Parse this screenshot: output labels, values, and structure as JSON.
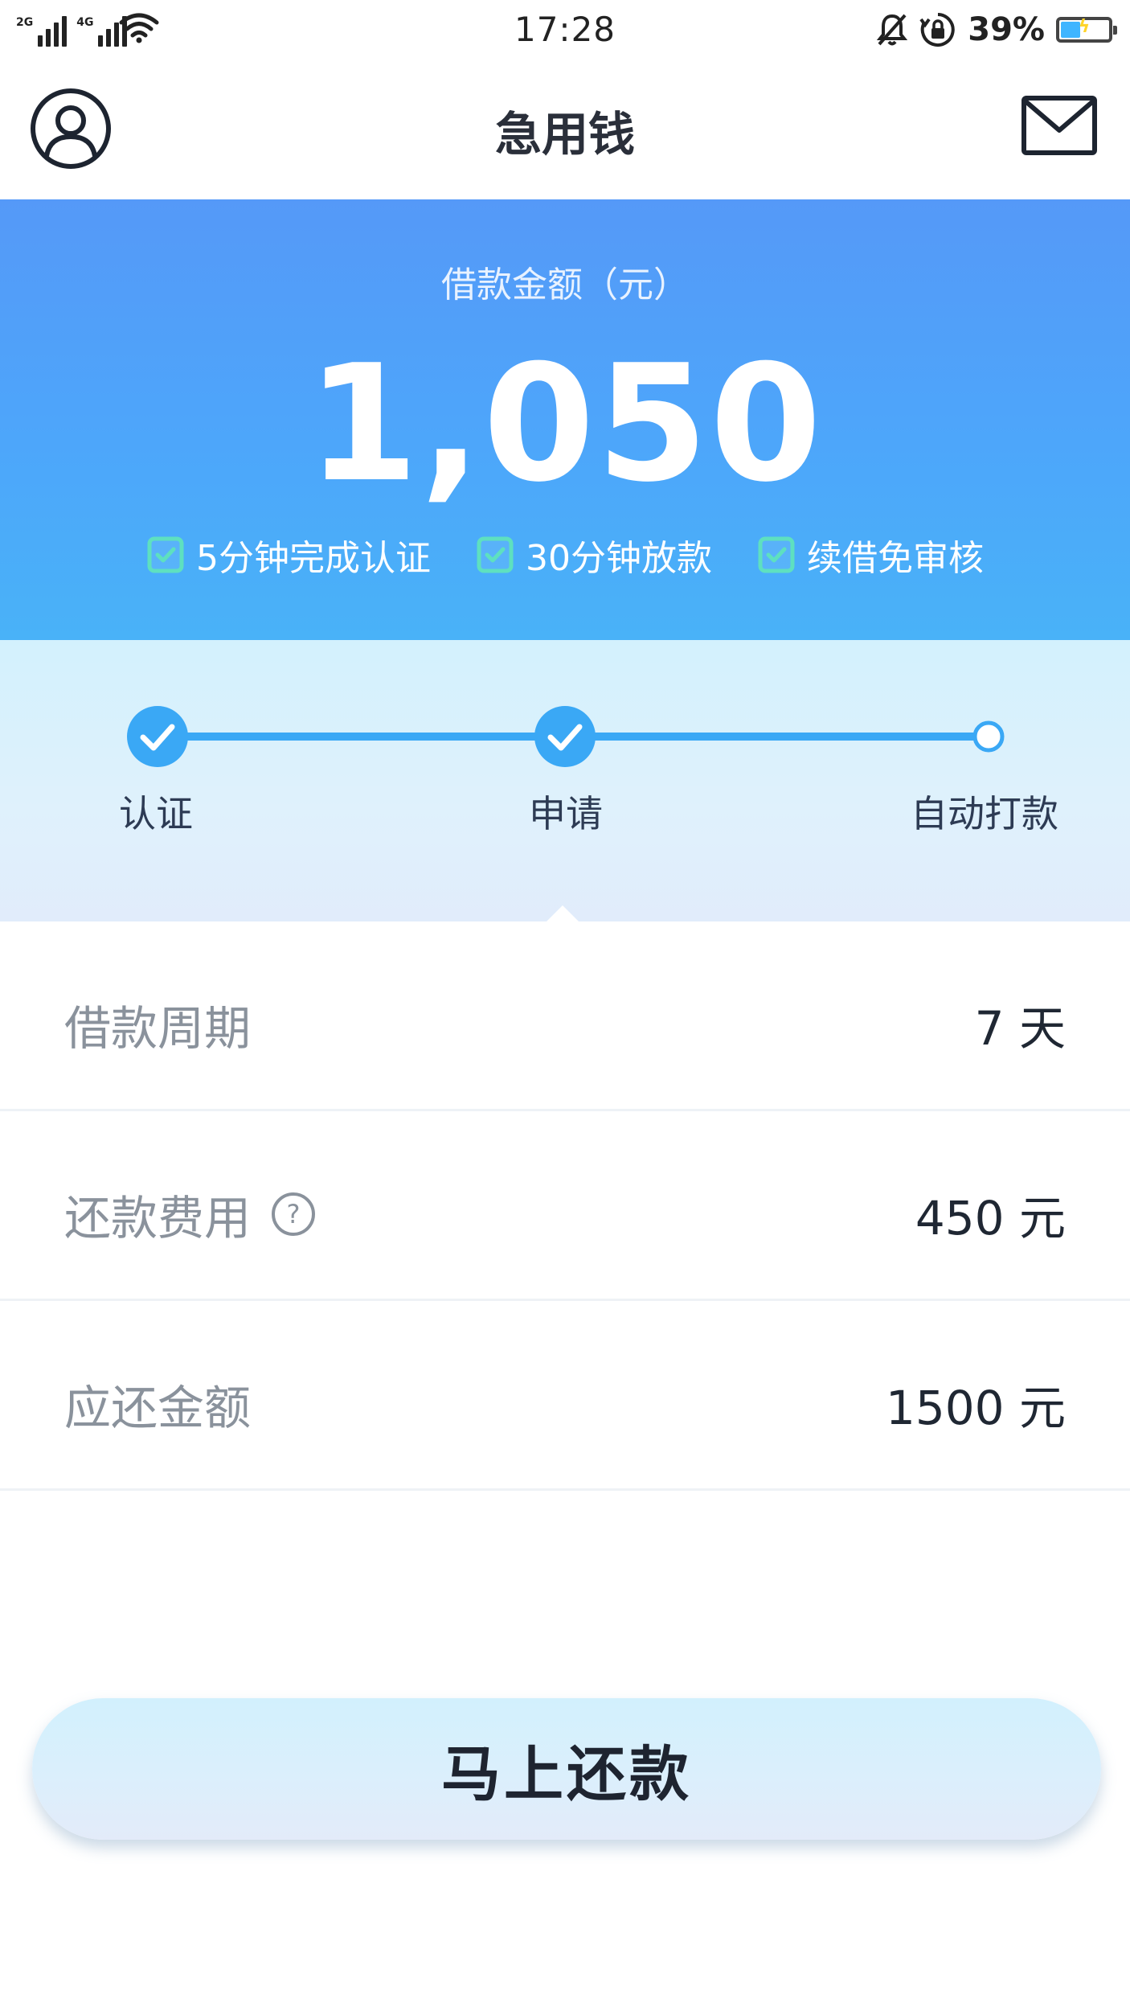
{
  "status_bar": {
    "time": "17:28",
    "battery_percent_label": "39%",
    "battery_level": 0.39,
    "network_tags": [
      "2G",
      "4G"
    ],
    "icons": [
      "signal-icon",
      "wifi-icon",
      "mute-icon",
      "rotation-lock-icon",
      "battery-icon"
    ]
  },
  "nav": {
    "title": "急用钱",
    "left_icon": "user-profile-icon",
    "right_icon": "mail-icon"
  },
  "hero": {
    "label": "借款金额（元）",
    "amount": "1,050",
    "features": [
      {
        "label": "5分钟完成认证",
        "icon": "checkbox-checked-icon"
      },
      {
        "label": "30分钟放款",
        "icon": "checkbox-checked-icon"
      },
      {
        "label": "续借免审核",
        "icon": "checkbox-checked-icon"
      }
    ]
  },
  "progress": {
    "steps": [
      {
        "label": "认证",
        "completed": true
      },
      {
        "label": "申请",
        "completed": true
      },
      {
        "label": "自动打款",
        "completed": false
      }
    ]
  },
  "details": [
    {
      "label": "借款周期",
      "value": "7 天",
      "has_help": false
    },
    {
      "label": "还款费用",
      "value": "450 元",
      "has_help": true,
      "help_icon": "help-circle-icon",
      "help_glyph": "?"
    },
    {
      "label": "应还金额",
      "value": "1500 元",
      "has_help": false
    }
  ],
  "action": {
    "repay_label": "马上还款"
  },
  "colors": {
    "hero_top": "#5599f8",
    "hero_bottom": "#49b2f8",
    "feature_check": "#5ee0c0",
    "step_done": "#3aa8f5",
    "panel_bg": "#d9f0fc",
    "label_gray": "#8a929c",
    "value_dark": "#1f2733"
  }
}
